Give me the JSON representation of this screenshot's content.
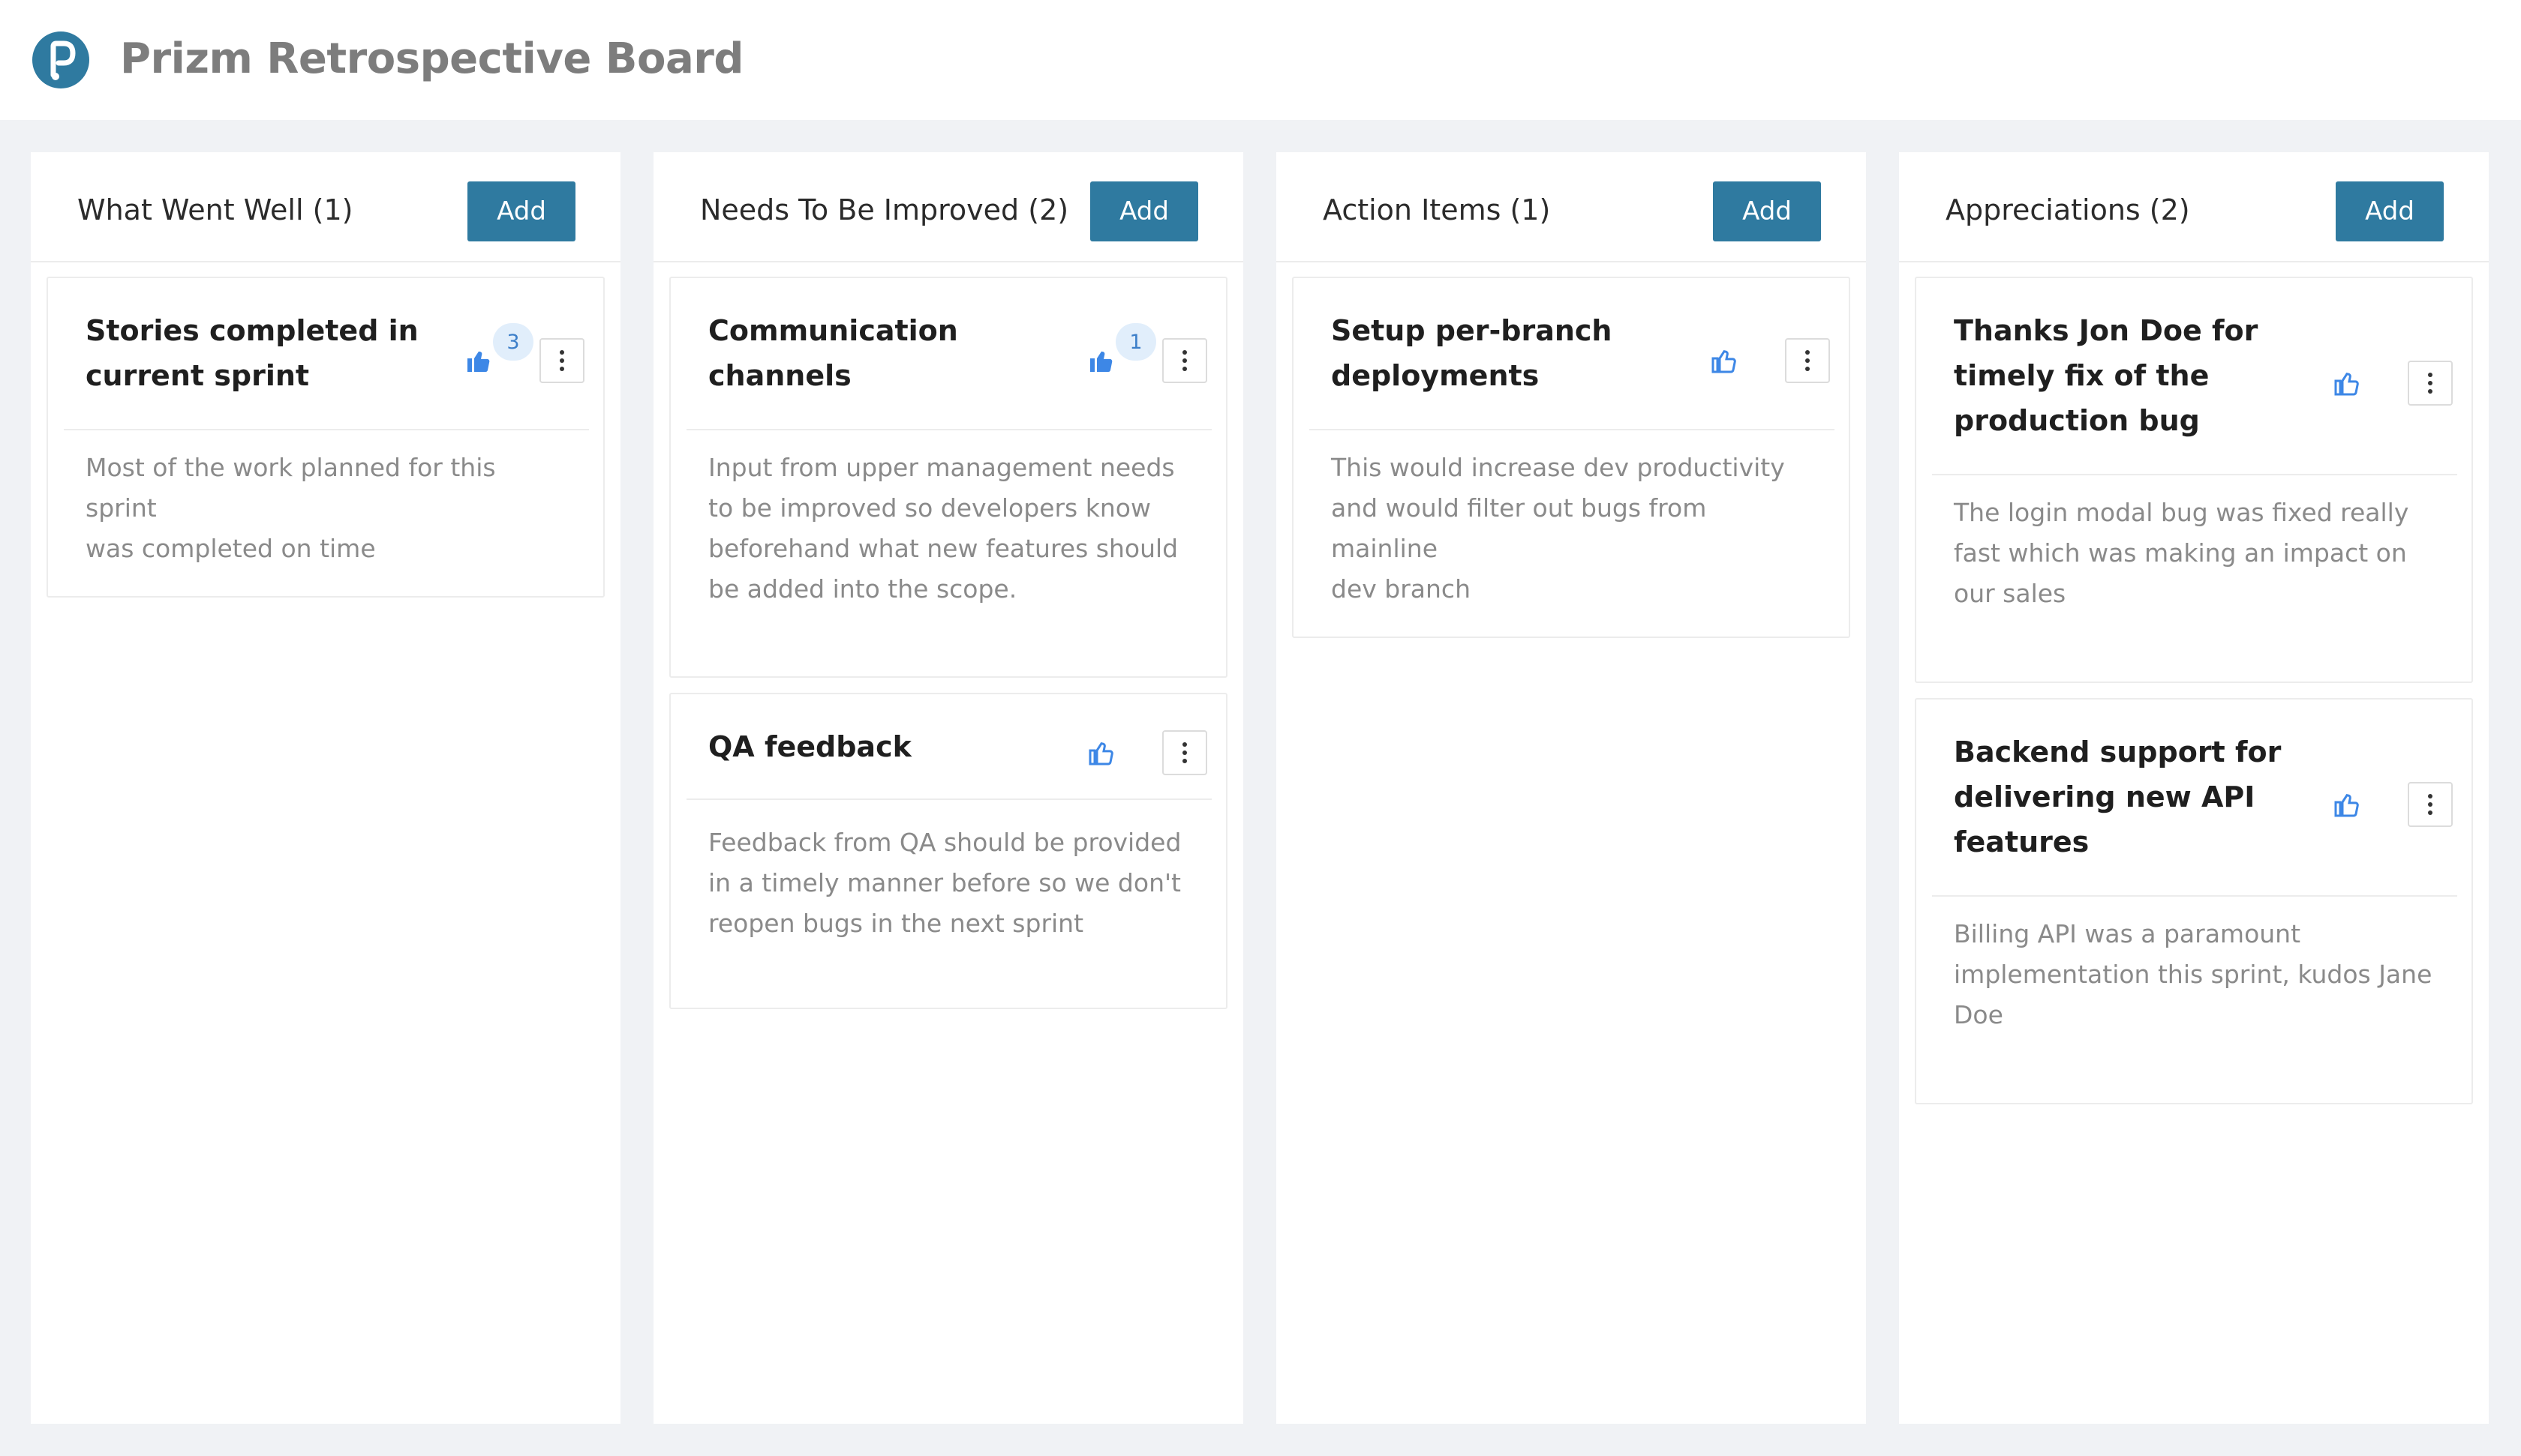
{
  "header": {
    "title": "Prizm Retrospective Board",
    "logo_letter": "P"
  },
  "columns": [
    {
      "title": "What Went Well (1)",
      "add_label": "Add",
      "cards": [
        {
          "title_lines": [
            "Stories completed in",
            "current sprint"
          ],
          "likes": "3",
          "desc_lines": [
            "Most of the work planned for this sprint",
            "was completed on time"
          ]
        }
      ]
    },
    {
      "title": "Needs To Be Improved (2)",
      "add_label": "Add",
      "cards": [
        {
          "title_lines": [
            "Communication",
            "channels"
          ],
          "likes": "1",
          "desc_lines": [
            "Input from upper management needs",
            "to be improved so developers know",
            "beforehand what new features should",
            "be added into the scope."
          ]
        },
        {
          "title_lines": [
            "QA feedback"
          ],
          "likes": null,
          "desc_lines": [
            "Feedback from QA should be provided",
            "in a timely manner before so we don't",
            "reopen bugs in the next sprint"
          ]
        }
      ]
    },
    {
      "title": "Action Items (1)",
      "add_label": "Add",
      "cards": [
        {
          "title_lines": [
            "Setup per-branch",
            "deployments"
          ],
          "likes": null,
          "desc_lines": [
            "This would increase dev productivity",
            "and would filter out bugs from mainline",
            "dev branch"
          ]
        }
      ]
    },
    {
      "title": "Appreciations (2)",
      "add_label": "Add",
      "cards": [
        {
          "title_lines": [
            "Thanks Jon Doe for",
            "timely fix of the",
            "production bug"
          ],
          "likes": null,
          "desc_lines": [
            "The login modal bug was fixed really",
            "fast which was making an impact on",
            "our sales"
          ]
        },
        {
          "title_lines": [
            "Backend support for",
            "delivering new API",
            "features"
          ],
          "likes": null,
          "desc_lines": [
            "Billing API was a paramount",
            "implementation this sprint, kudos Jane",
            "Doe"
          ]
        }
      ]
    }
  ],
  "colors": {
    "accent": "#2f7aa0",
    "like_blue": "#3d87e6",
    "background": "#f0f2f5"
  },
  "icons": {
    "like": "thumbs-up-icon",
    "menu": "vertical-dots-icon"
  }
}
